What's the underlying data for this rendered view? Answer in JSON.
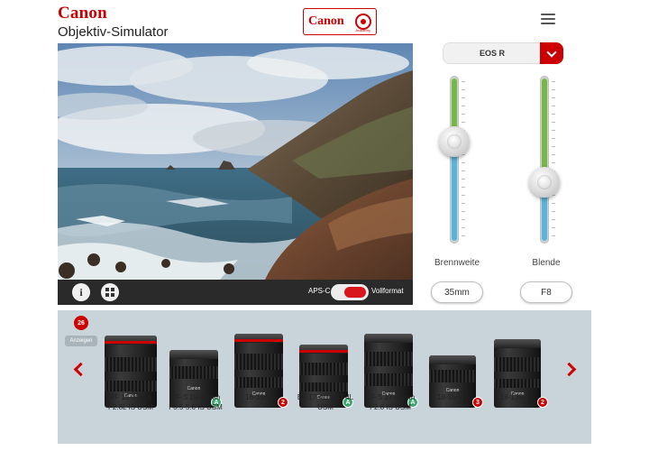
{
  "header": {
    "brand": "Canon",
    "title": "Objektiv-Simulator",
    "academy_logo": "Canon",
    "academy_sub": "Academy",
    "menu_icon": "hamburger-menu-icon"
  },
  "photo": {
    "toolbar": {
      "info_icon": "info-icon",
      "info_glyph": "i",
      "grid_icon": "grid-icon",
      "format_left": "APS-C",
      "format_right": "Vollformat",
      "format_value": "Vollformat"
    }
  },
  "camera": {
    "selected": "EOS R"
  },
  "sliders": {
    "focal": {
      "label": "Brennweite",
      "value": "35mm",
      "level": 0.61
    },
    "aperture": {
      "label": "Blende",
      "value": "F8",
      "level": 0.36
    }
  },
  "lens_strip": {
    "count": "26",
    "show_label": "Anzeigen",
    "lenses": [
      {
        "name_line1": "RF 15-35mm",
        "name_line2": "F2.8L IS USM",
        "badge": ""
      },
      {
        "name_line1": "EF-S 15-85mm",
        "name_line2": "F3.5-5.6 IS USM",
        "badge": "A"
      },
      {
        "name_line1": "16-35mm",
        "name_line2": "",
        "badge": "2"
      },
      {
        "name_line1": "EF 17-40mm F4L",
        "name_line2": "USM",
        "badge": "A"
      },
      {
        "name_line1": "EF-S 17-55mm",
        "name_line2": "F2.8 IS USM",
        "badge": "A"
      },
      {
        "name_line1": "18-55mm",
        "name_line2": "",
        "badge": "3"
      },
      {
        "name_line1": "18-135mm",
        "name_line2": "",
        "badge": "2"
      }
    ]
  },
  "colors": {
    "accent": "#cc0000",
    "strip_background": "#c9d4da",
    "slider_upper": "#74b943",
    "slider_lower": "#54b6e0",
    "badge_green": "#3aa66d"
  }
}
